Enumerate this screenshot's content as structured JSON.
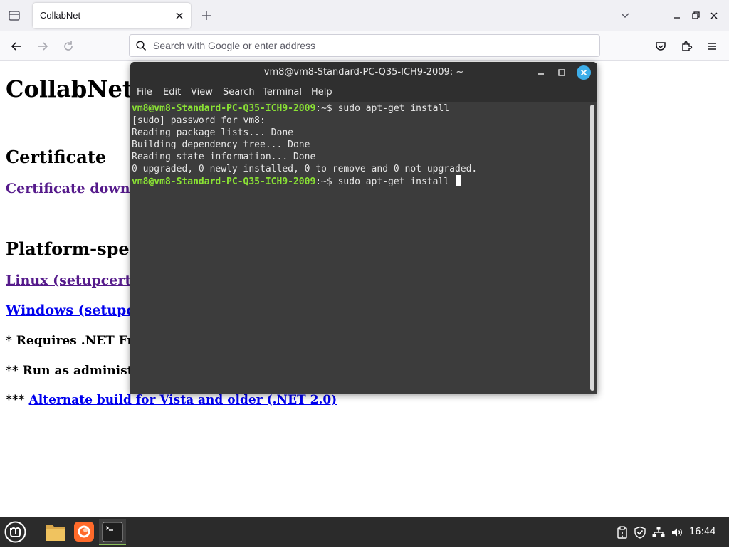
{
  "browser": {
    "tab": {
      "title": "CollabNet"
    },
    "urlbar": {
      "placeholder": "Search with Google or enter address"
    }
  },
  "page": {
    "title": "CollabNet",
    "certificate_heading": "Certificate",
    "certificate_link": "Certificate downl",
    "platform_heading": "Platform-spec",
    "linux_link": "Linux (setupcert",
    "windows_link": "Windows (setupc",
    "note1": "* Requires .NET Fra",
    "note2": "** Run as administr",
    "note3_prefix": "***",
    "note3_link": "Alternate build for Vista and older (.NET 2.0)"
  },
  "terminal": {
    "title": "vm8@vm8-Standard-PC-Q35-ICH9-2009: ~",
    "menu": [
      "File",
      "Edit",
      "View",
      "Search",
      "Terminal",
      "Help"
    ],
    "prompt_user": "vm8@vm8-Standard-PC-Q35-ICH9-2009",
    "prompt_suffix": ":~$ ",
    "lines": [
      {
        "kind": "prompt",
        "command": "sudo apt-get install"
      },
      {
        "kind": "output",
        "text": "[sudo] password for vm8:"
      },
      {
        "kind": "output",
        "text": "Reading package lists... Done"
      },
      {
        "kind": "output",
        "text": "Building dependency tree... Done"
      },
      {
        "kind": "output",
        "text": "Reading state information... Done"
      },
      {
        "kind": "output",
        "text": "0 upgraded, 0 newly installed, 0 to remove and 0 not upgraded."
      },
      {
        "kind": "prompt",
        "command": "sudo apt-get install "
      }
    ]
  },
  "taskbar": {
    "apps": [
      "menu-icon",
      "files-icon",
      "firefox-icon",
      "terminal-icon"
    ],
    "tray": [
      "clipboard-icon",
      "shield-icon",
      "network-icon",
      "volume-icon"
    ],
    "clock": "16:44"
  },
  "colors": {
    "prompt_green": "#8ae234",
    "terminal_bg": "#3c3c3c",
    "close_blue": "#3daee9",
    "mint_green": "#8cc05c",
    "firefox_orange": "#ff6a2a"
  }
}
